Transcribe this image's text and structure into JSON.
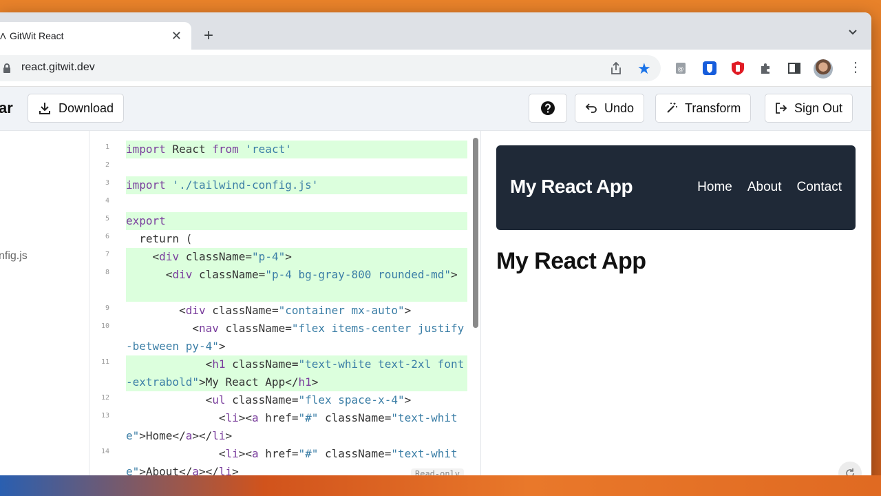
{
  "browser": {
    "tab_favicon": "Ʌ",
    "tab_title": "GitWit React",
    "tab_close": "✕",
    "new_tab": "+",
    "url": "react.gitwit.dev",
    "star": "★",
    "menu": "⋮"
  },
  "app": {
    "brand_fragment": "ar",
    "download_label": "Download",
    "undo_label": "Undo",
    "transform_label": "Transform",
    "signout_label": "Sign Out"
  },
  "sidebar": {
    "file_fragment": "nfig.js"
  },
  "editor": {
    "read_only_label": "Read-only",
    "lines": [
      {
        "n": "1",
        "highlight": true,
        "segments": [
          {
            "t": "import",
            "c": "kw"
          },
          {
            "t": " React ",
            "c": ""
          },
          {
            "t": "from",
            "c": "kw"
          },
          {
            "t": " ",
            "c": ""
          },
          {
            "t": "'react'",
            "c": "str"
          }
        ]
      },
      {
        "n": "2",
        "highlight": false,
        "segments": []
      },
      {
        "n": "3",
        "highlight": true,
        "segments": [
          {
            "t": "import",
            "c": "kw"
          },
          {
            "t": " ",
            "c": ""
          },
          {
            "t": "'./tailwind-config.js'",
            "c": "str"
          }
        ]
      },
      {
        "n": "4",
        "highlight": false,
        "segments": []
      },
      {
        "n": "5",
        "highlight": true,
        "segments": [
          {
            "t": "export",
            "c": "kw"
          }
        ]
      },
      {
        "n": "6",
        "highlight": false,
        "segments": [
          {
            "t": "  return (",
            "c": ""
          }
        ]
      },
      {
        "n": "7",
        "highlight": true,
        "segments": [
          {
            "t": "    <",
            "c": ""
          },
          {
            "t": "div",
            "c": "kw"
          },
          {
            "t": " className=",
            "c": ""
          },
          {
            "t": "\"p-4\"",
            "c": "str"
          },
          {
            "t": ">",
            "c": ""
          }
        ]
      },
      {
        "n": "8",
        "highlight": true,
        "segments": [
          {
            "t": "      <",
            "c": ""
          },
          {
            "t": "div",
            "c": "kw"
          },
          {
            "t": " className=",
            "c": ""
          },
          {
            "t": "\"p-4 bg-gray-800 rounded-md\"",
            "c": "str"
          },
          {
            "t": ">",
            "c": ""
          }
        ]
      },
      {
        "n": "9",
        "highlight": false,
        "segments": [
          {
            "t": "        <",
            "c": ""
          },
          {
            "t": "div",
            "c": "kw"
          },
          {
            "t": " className=",
            "c": ""
          },
          {
            "t": "\"container mx-auto\"",
            "c": "str"
          },
          {
            "t": ">",
            "c": ""
          }
        ]
      },
      {
        "n": "10",
        "highlight": false,
        "segments": [
          {
            "t": "          <",
            "c": ""
          },
          {
            "t": "nav",
            "c": "kw"
          },
          {
            "t": " className=",
            "c": ""
          },
          {
            "t": "\"flex items-center justify-between py-4\"",
            "c": "str"
          },
          {
            "t": ">",
            "c": ""
          }
        ]
      },
      {
        "n": "11",
        "highlight": true,
        "segments": [
          {
            "t": "            <",
            "c": ""
          },
          {
            "t": "h1",
            "c": "kw"
          },
          {
            "t": " className=",
            "c": ""
          },
          {
            "t": "\"text-white text-2xl font-extrabold\"",
            "c": "str"
          },
          {
            "t": ">My React App</",
            "c": ""
          },
          {
            "t": "h1",
            "c": "kw"
          },
          {
            "t": ">",
            "c": ""
          }
        ]
      },
      {
        "n": "12",
        "highlight": false,
        "segments": [
          {
            "t": "            <",
            "c": ""
          },
          {
            "t": "ul",
            "c": "kw"
          },
          {
            "t": " className=",
            "c": ""
          },
          {
            "t": "\"flex space-x-4\"",
            "c": "str"
          },
          {
            "t": ">",
            "c": ""
          }
        ]
      },
      {
        "n": "13",
        "highlight": false,
        "segments": [
          {
            "t": "              <",
            "c": ""
          },
          {
            "t": "li",
            "c": "kw"
          },
          {
            "t": "><",
            "c": ""
          },
          {
            "t": "a",
            "c": "kw"
          },
          {
            "t": " href=",
            "c": ""
          },
          {
            "t": "\"#\"",
            "c": "str"
          },
          {
            "t": " className=",
            "c": ""
          },
          {
            "t": "\"text-white\"",
            "c": "str"
          },
          {
            "t": ">Home</",
            "c": ""
          },
          {
            "t": "a",
            "c": "kw"
          },
          {
            "t": "></",
            "c": ""
          },
          {
            "t": "li",
            "c": "kw"
          },
          {
            "t": ">",
            "c": ""
          }
        ]
      },
      {
        "n": "14",
        "highlight": false,
        "segments": [
          {
            "t": "              <",
            "c": ""
          },
          {
            "t": "li",
            "c": "kw"
          },
          {
            "t": "><",
            "c": ""
          },
          {
            "t": "a",
            "c": "kw"
          },
          {
            "t": " href=",
            "c": ""
          },
          {
            "t": "\"#\"",
            "c": "str"
          },
          {
            "t": " className=",
            "c": ""
          },
          {
            "t": "\"text-white\"",
            "c": "str"
          },
          {
            "t": ">About</",
            "c": ""
          },
          {
            "t": "a",
            "c": "kw"
          },
          {
            "t": "></",
            "c": ""
          },
          {
            "t": "li",
            "c": "kw"
          },
          {
            "t": ">",
            "c": ""
          }
        ]
      }
    ]
  },
  "preview": {
    "nav_title": "My React App",
    "nav_links": [
      "Home",
      "About",
      "Contact"
    ],
    "heading": "My React App"
  },
  "colors": {
    "nav_bg": "#1f2937",
    "highlight_bg": "#dcffdd",
    "bookmark_star": "#1a73e8"
  }
}
